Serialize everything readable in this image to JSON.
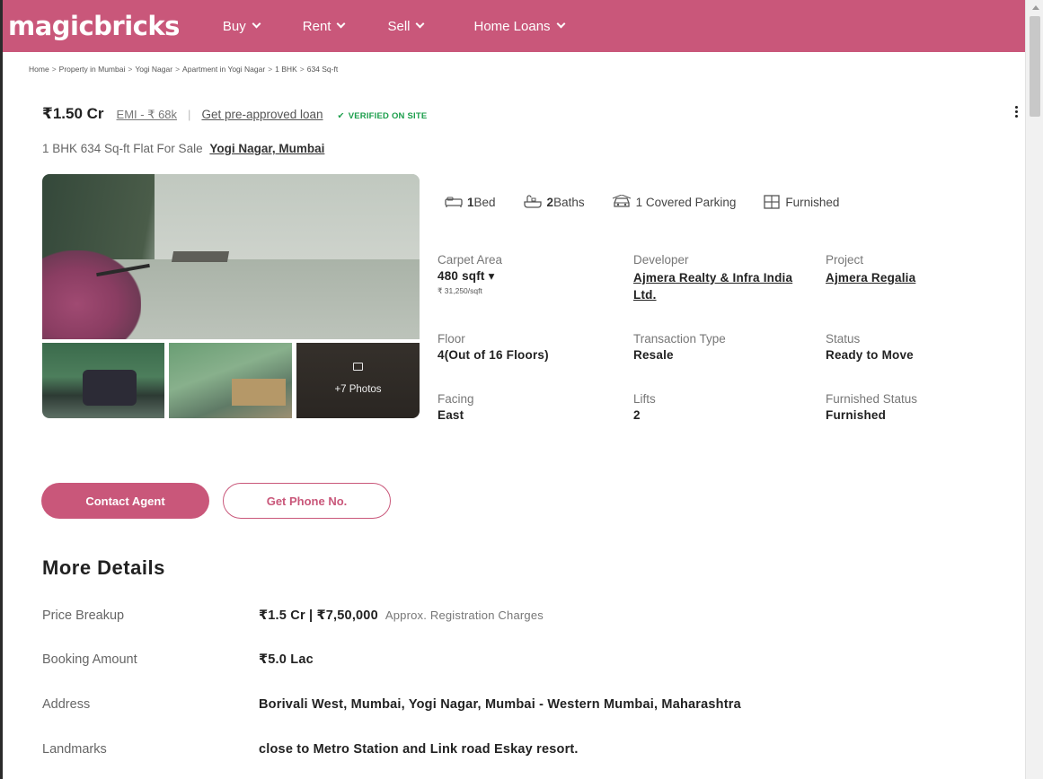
{
  "brand": {
    "logo": "magicbricks",
    "accent": "#c9577a"
  },
  "nav": {
    "items": [
      {
        "label": "Buy"
      },
      {
        "label": "Rent"
      },
      {
        "label": "Sell"
      },
      {
        "label": "Home Loans"
      }
    ]
  },
  "breadcrumb": [
    "Home",
    "Property in Mumbai",
    "Yogi Nagar",
    "Apartment in Yogi Nagar",
    "1 BHK",
    "634 Sq-ft"
  ],
  "breadcrumb_sep": ">",
  "listing": {
    "price": "₹1.50 Cr",
    "emi": "EMI - ₹ 68k",
    "divider": "|",
    "preapproved": "Get pre-approved loan",
    "verified": "VERIFIED ON SITE",
    "title": "1 BHK 634 Sq-ft Flat For Sale",
    "location": "Yogi Nagar, Mumbai"
  },
  "gallery": {
    "more_photos": "+7 Photos"
  },
  "features": {
    "bed_count": "1",
    "bed_label": "Bed",
    "bath_count": "2",
    "bath_label": "Baths",
    "parking": "1 Covered Parking",
    "furnished": "Furnished"
  },
  "specs": {
    "carpet_area": {
      "label": "Carpet Area",
      "value": "480 sqft",
      "sub": "₹ 31,250/sqft"
    },
    "developer": {
      "label": "Developer",
      "value": "Ajmera Realty & Infra India Ltd."
    },
    "project": {
      "label": "Project",
      "value": "Ajmera Regalia"
    },
    "floor": {
      "label": "Floor",
      "value": "4(Out of 16 Floors)"
    },
    "transaction": {
      "label": "Transaction Type",
      "value": "Resale"
    },
    "status": {
      "label": "Status",
      "value": "Ready to Move"
    },
    "facing": {
      "label": "Facing",
      "value": "East"
    },
    "lifts": {
      "label": "Lifts",
      "value": "2"
    },
    "furnished_status": {
      "label": "Furnished Status",
      "value": "Furnished"
    }
  },
  "actions": {
    "contact": "Contact Agent",
    "phone": "Get Phone No."
  },
  "more_details": {
    "title": "More Details",
    "price_breakup": {
      "label": "Price Breakup",
      "value": "₹1.5 Cr | ₹7,50,000",
      "note": "Approx. Registration Charges"
    },
    "booking": {
      "label": "Booking Amount",
      "value": "₹5.0 Lac"
    },
    "address": {
      "label": "Address",
      "value": "Borivali West, Mumbai, Yogi Nagar, Mumbai - Western Mumbai, Maharashtra"
    },
    "landmarks": {
      "label": "Landmarks",
      "value": "close to Metro Station and Link road Eskay resort."
    }
  }
}
